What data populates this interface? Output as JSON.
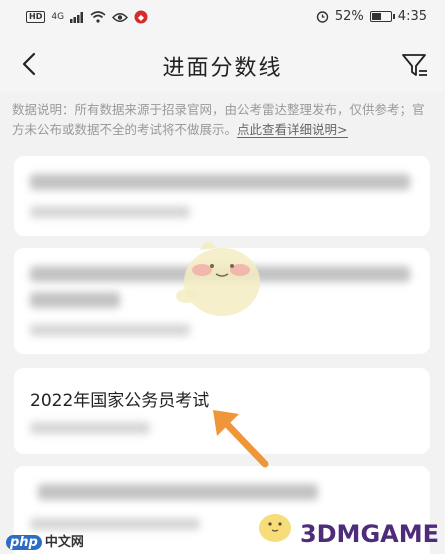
{
  "status_bar": {
    "left_hd": "HD",
    "left_network": "4G",
    "battery_text": "52%",
    "battery_level": 0.52,
    "time": "4:35"
  },
  "nav": {
    "title": "进面分数线",
    "back_icon": "chevron-left-icon",
    "filter_icon": "filter-icon"
  },
  "notice": {
    "text": "数据说明：所有数据来源于招录官网，由公考雷达整理发布，仅供参考；官方未公布或数据不全的考试将不做展示。",
    "link": "点此查看详细说明>"
  },
  "cards": [
    {
      "title": ""
    },
    {
      "title": ""
    },
    {
      "title": "2022年国家公务员考试"
    },
    {
      "title": ""
    }
  ],
  "watermarks": {
    "php": "中文网",
    "php_mark": "php",
    "game": "3DMGAME"
  },
  "colors": {
    "accent_arrow": "#f0963a",
    "background": "#f2f2f2",
    "card": "#ffffff"
  }
}
